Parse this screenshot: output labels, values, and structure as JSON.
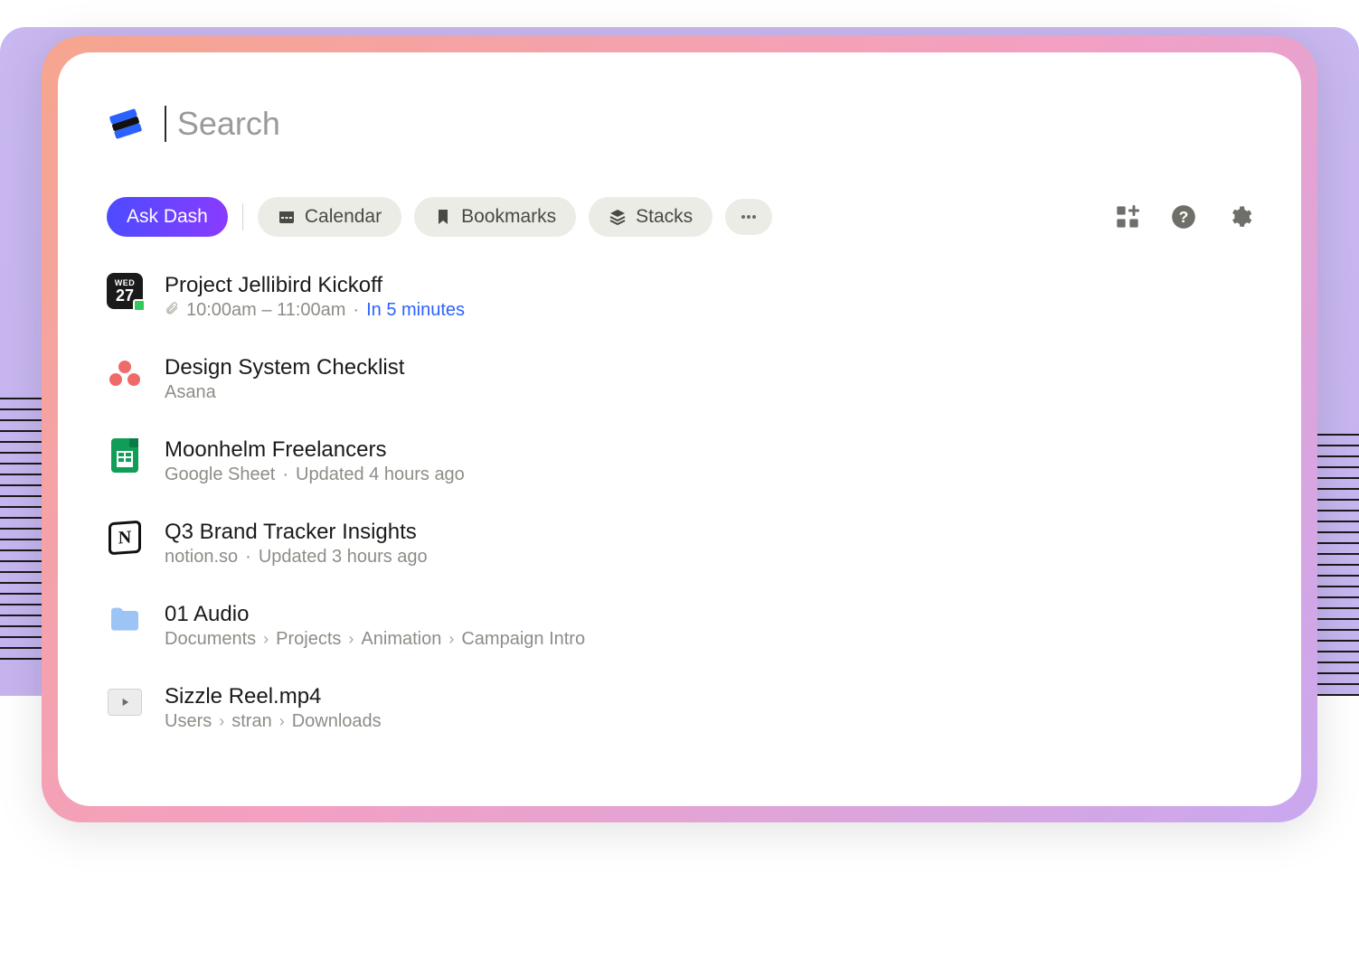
{
  "search": {
    "placeholder": "Search",
    "value": ""
  },
  "chips": {
    "ask": "Ask Dash",
    "calendar": "Calendar",
    "bookmarks": "Bookmarks",
    "stacks": "Stacks"
  },
  "items": [
    {
      "title": "Project Jellibird Kickoff",
      "time_range": "10:00am – 11:00am",
      "countdown": "In 5 minutes",
      "dow": "WED",
      "dom": "27"
    },
    {
      "title": "Design System Checklist",
      "source": "Asana"
    },
    {
      "title": "Moonhelm Freelancers",
      "source": "Google Sheet",
      "updated": "Updated 4 hours ago"
    },
    {
      "title": "Q3 Brand Tracker Insights",
      "source": "notion.so",
      "updated": "Updated 3 hours ago"
    },
    {
      "title": "01 Audio",
      "crumbs": [
        "Documents",
        "Projects",
        "Animation",
        "Campaign Intro"
      ]
    },
    {
      "title": "Sizzle Reel.mp4",
      "crumbs": [
        "Users",
        "stran",
        "Downloads"
      ]
    }
  ]
}
